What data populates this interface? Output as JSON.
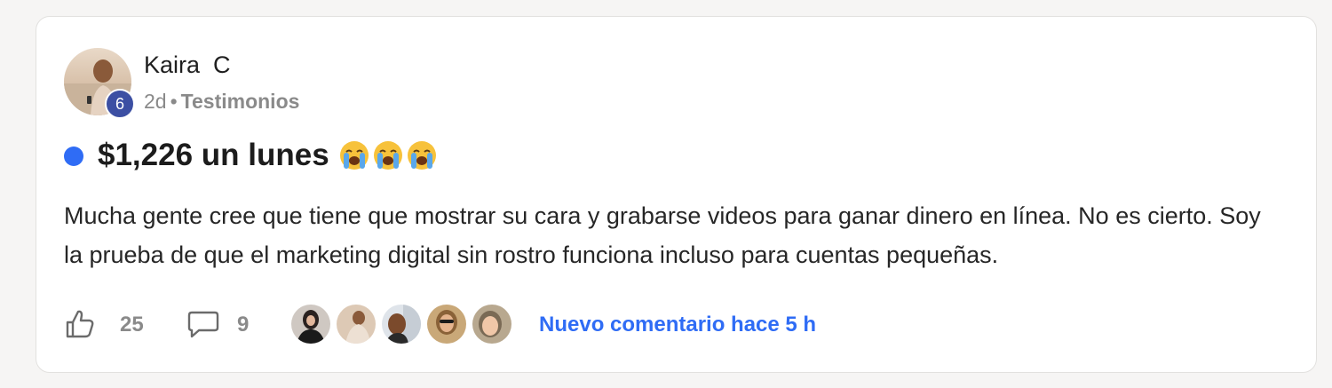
{
  "post": {
    "author": "Kaira  C",
    "level": "6",
    "time": "2d",
    "separator": "•",
    "category": "Testimonios",
    "title": "$1,226 un lunes",
    "title_emojis": [
      "loudly-crying-face",
      "loudly-crying-face",
      "loudly-crying-face"
    ],
    "body": "Mucha gente cree que tiene que mostrar su cara y grabarse videos para ganar dinero en línea. No es cierto. Soy la prueba de que el marketing digital sin rostro funciona incluso para cuentas pequeñas.",
    "likes": "25",
    "comments": "9",
    "last_comment": "Nuevo comentario hace 5 h"
  },
  "colors": {
    "accent": "#2f6cf5",
    "level_badge": "#3c4fa3",
    "muted_text": "#8a8a8a",
    "card_bg": "#ffffff",
    "page_bg": "#f6f5f4"
  },
  "icons": {
    "like": "thumbs-up-icon",
    "comment": "speech-bubble-icon"
  }
}
